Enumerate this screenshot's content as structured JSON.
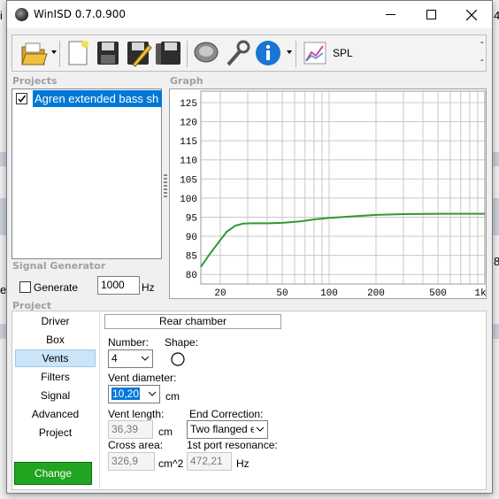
{
  "window": {
    "title": "WinISD 0.7.0.900"
  },
  "toolbar": {
    "items": [
      {
        "name": "open-icon"
      },
      {
        "name": "new-icon"
      },
      {
        "name": "save-icon"
      },
      {
        "name": "edit-icon"
      },
      {
        "name": "save-all-icon"
      },
      {
        "name": "driver-icon"
      },
      {
        "name": "tools-icon"
      },
      {
        "name": "info-icon"
      }
    ],
    "spl_label": "SPL"
  },
  "projects": {
    "label": "Projects",
    "item": "Agren extended bass sh"
  },
  "graph": {
    "label": "Graph",
    "y_ticks": [
      "125",
      "120",
      "115",
      "110",
      "105",
      "100",
      "95",
      "90",
      "85",
      "80"
    ],
    "x_ticks": [
      "20",
      "50",
      "100",
      "200",
      "500",
      "1k"
    ]
  },
  "chart_data": {
    "type": "line",
    "x_scale": "log",
    "xlim": [
      15,
      1000
    ],
    "ylim": [
      77.5,
      128
    ],
    "series": [
      {
        "color": "#2e9a2e",
        "x": [
          15,
          17,
          20,
          22,
          25,
          28,
          32,
          40,
          50,
          65,
          80,
          100,
          150,
          200,
          300,
          500,
          1000
        ],
        "y": [
          82,
          85.2,
          89,
          91.2,
          92.8,
          93.3,
          93.4,
          93.4,
          93.5,
          93.9,
          94.4,
          94.8,
          95.3,
          95.6,
          95.8,
          95.9,
          95.9
        ]
      }
    ]
  },
  "signal_generator": {
    "label": "Signal Generator",
    "checkbox_label": "Generate",
    "frequency": "1000",
    "unit": "Hz"
  },
  "project": {
    "label": "Project",
    "side_items": [
      "Driver",
      "Box",
      "Vents",
      "Filters",
      "Signal",
      "Advanced",
      "Project"
    ],
    "selected": "Vents",
    "change_label": "Change"
  },
  "vents": {
    "section_title": "Rear chamber",
    "number_label": "Number:",
    "number_value": "4",
    "shape_label": "Shape:",
    "diameter_label": "Vent diameter:",
    "diameter_value": "10,20",
    "diameter_unit": "cm",
    "length_label": "Vent length:",
    "length_value": "36,39",
    "length_unit": "cm",
    "end_correction_label": "End Correction:",
    "end_correction_value": "Two flanged e",
    "area_label": "Cross area:",
    "area_value": "326,9",
    "area_unit": "cm^2",
    "resonance_label": "1st port resonance:",
    "resonance_value": "472,21",
    "resonance_unit": "Hz"
  },
  "background": {
    "fragments": [
      "i",
      "4",
      "ex",
      "8"
    ]
  }
}
